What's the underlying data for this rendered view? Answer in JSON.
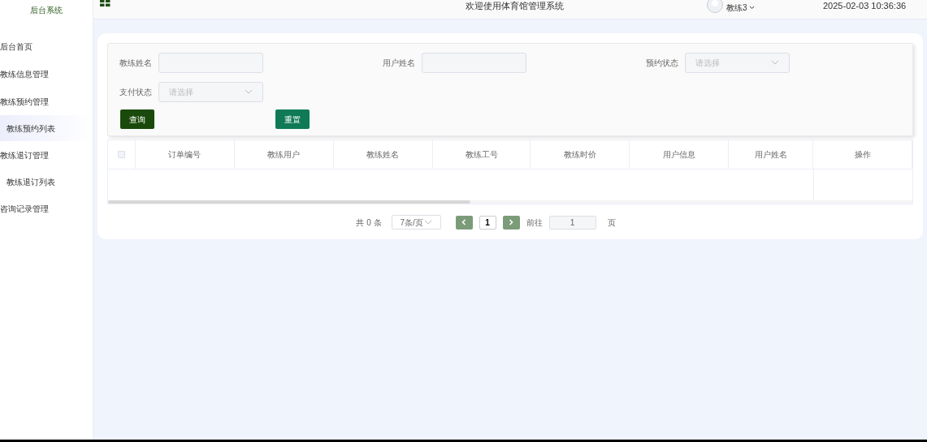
{
  "sidebar": {
    "title": "后台系统",
    "items": [
      {
        "label": "后台首页",
        "selected": false
      },
      {
        "label": "教练信息管理",
        "selected": false
      },
      {
        "label": "教练预约管理",
        "selected": false,
        "children": [
          {
            "label": "教练预约列表",
            "selected": true
          }
        ]
      },
      {
        "label": "教练退订管理",
        "selected": false,
        "children": [
          {
            "label": "教练退订列表",
            "selected": false
          }
        ]
      },
      {
        "label": "咨询记录管理",
        "selected": false
      }
    ]
  },
  "header": {
    "title": "欢迎使用体育馆管理系统",
    "user": "教练3",
    "datetime": "2025-02-03 10:36:36"
  },
  "filters": [
    {
      "kind": "input",
      "label": "教练姓名"
    },
    {
      "kind": "input",
      "label": "用户姓名"
    },
    {
      "kind": "select",
      "label": "预约状态",
      "placeholder": "请选择"
    },
    {
      "kind": "select",
      "label": "支付状态",
      "placeholder": "请选择"
    }
  ],
  "buttons": {
    "search": "查询",
    "reset": "重置"
  },
  "table": {
    "select_all_checked": false,
    "columns": [
      "订单编号",
      "教练用户",
      "教练姓名",
      "教练工号",
      "教练时价",
      "用户信息",
      "用户姓名",
      "操作"
    ]
  },
  "pagination": {
    "total": "共 0 条",
    "page_size": "7条/页",
    "pages": [
      {
        "label": "1",
        "selected": true
      }
    ],
    "goto_label": "前往",
    "goto_value": "1",
    "page_suffix": "页"
  }
}
